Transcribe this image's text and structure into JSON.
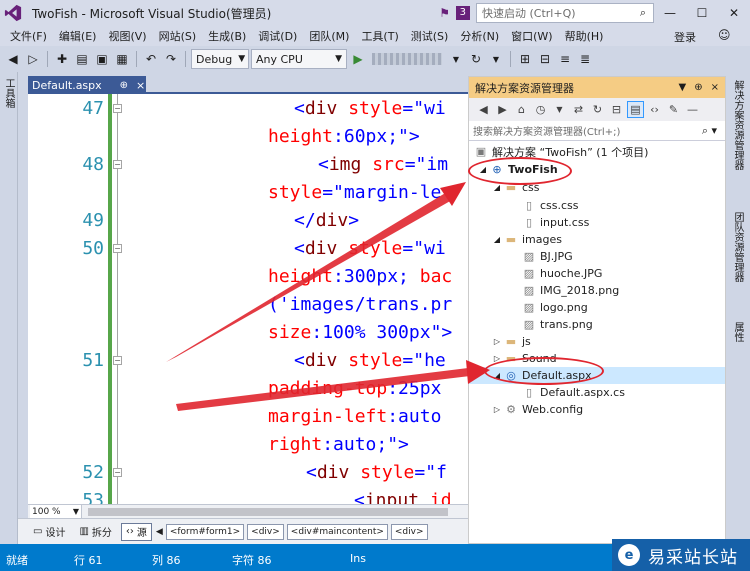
{
  "window": {
    "title": "TwoFish - Microsoft Visual Studio(管理员)",
    "notification_count": "3",
    "quick_launch_placeholder": "快速启动 (Ctrl+Q)"
  },
  "menu": {
    "items": [
      "文件(F)",
      "编辑(E)",
      "视图(V)",
      "网站(S)",
      "生成(B)",
      "调试(D)",
      "团队(M)",
      "工具(T)",
      "测试(S)",
      "分析(N)",
      "窗口(W)",
      "帮助(H)"
    ],
    "login": "登录"
  },
  "toolbar": {
    "config": "Debug",
    "platform": "Any CPU"
  },
  "left_strip": {
    "toolbox": "工具箱"
  },
  "document_tab": {
    "title": "Default.aspx",
    "pin": "⊕",
    "close": "×"
  },
  "editor": {
    "line_numbers": [
      "47",
      "48",
      "49",
      "50",
      "51",
      "52",
      "53"
    ],
    "zoom": "100 %"
  },
  "view_bar": {
    "design": "设计",
    "split": "拆分",
    "source": "源",
    "breadcrumbs": [
      "<form#form1>",
      "<div>",
      "<div#maincontent>",
      "<div>"
    ]
  },
  "solution_explorer": {
    "title": "解决方案资源管理器",
    "search_placeholder": "搜索解决方案资源管理器(Ctrl+;)",
    "tree": {
      "solution": "解决方案 “TwoFish” (1 个项目)",
      "project": "TwoFish",
      "css_folder": "css",
      "css_file": "css.css",
      "input_file": "input.css",
      "images_folder": "images",
      "img1": "BJ.JPG",
      "img2": "huoche.JPG",
      "img3": "IMG_2018.png",
      "img4": "logo.png",
      "img5": "trans.png",
      "js_folder": "js",
      "sound_folder": "Sound",
      "default_aspx": "Default.aspx",
      "default_cs": "Default.aspx.cs",
      "web_config": "Web.config"
    }
  },
  "right_strip": {
    "tab1": "解决方案资源管理器",
    "tab2": "团队资源管理器",
    "tab3": "属性"
  },
  "status_bar": {
    "state": "就绪",
    "row": "行 61",
    "col": "列 86",
    "char": "字符 86",
    "mode": "Ins"
  },
  "watermark": {
    "text": "易采站长站",
    "logo": "e"
  },
  "colors": {
    "accent": "#007acc",
    "tab": "#3c5a96",
    "se_title": "#f5cc84",
    "annotation": "#e0262f"
  }
}
